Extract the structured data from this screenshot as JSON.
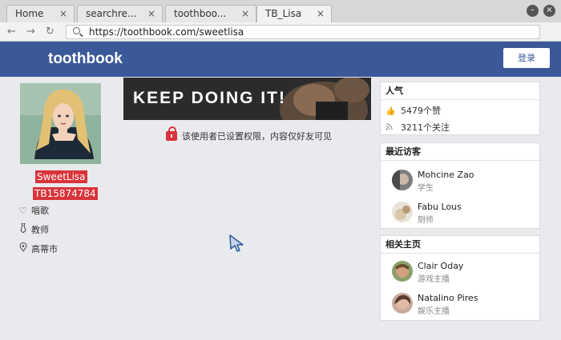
{
  "browser": {
    "tabs": [
      {
        "label": "Home"
      },
      {
        "label": "searchre..."
      },
      {
        "label": "toothboo..."
      },
      {
        "label": "TB_Lisa"
      }
    ],
    "close_glyph": "×",
    "url": "https://toothbook.com/sweetlisa"
  },
  "header": {
    "logo": "toothbook",
    "login_label": "登录",
    "brand_color": "#3b5998"
  },
  "profile": {
    "username": "SweetLisa",
    "user_id": "TB15874784",
    "hobby": "唱歌",
    "occupation": "教师",
    "location": "高蒂市",
    "badge_color": "#d9343b"
  },
  "main": {
    "banner_text": "KEEP DOING IT!",
    "privacy_notice": "该使用者已设置权限，内容仅好友可见"
  },
  "popularity": {
    "title": "人气",
    "likes": "5479个赞",
    "followers": "3211个关注"
  },
  "recent_visitors": {
    "title": "最近访客",
    "people": [
      {
        "name": "Mohcine Zao",
        "role": "学生"
      },
      {
        "name": "Fabu Lous",
        "role": "厨师"
      }
    ]
  },
  "related_pages": {
    "title": "相关主页",
    "people": [
      {
        "name": "Clair Oday",
        "role": "游戏主播"
      },
      {
        "name": "Natalino Pires",
        "role": "娱乐主播"
      }
    ]
  }
}
